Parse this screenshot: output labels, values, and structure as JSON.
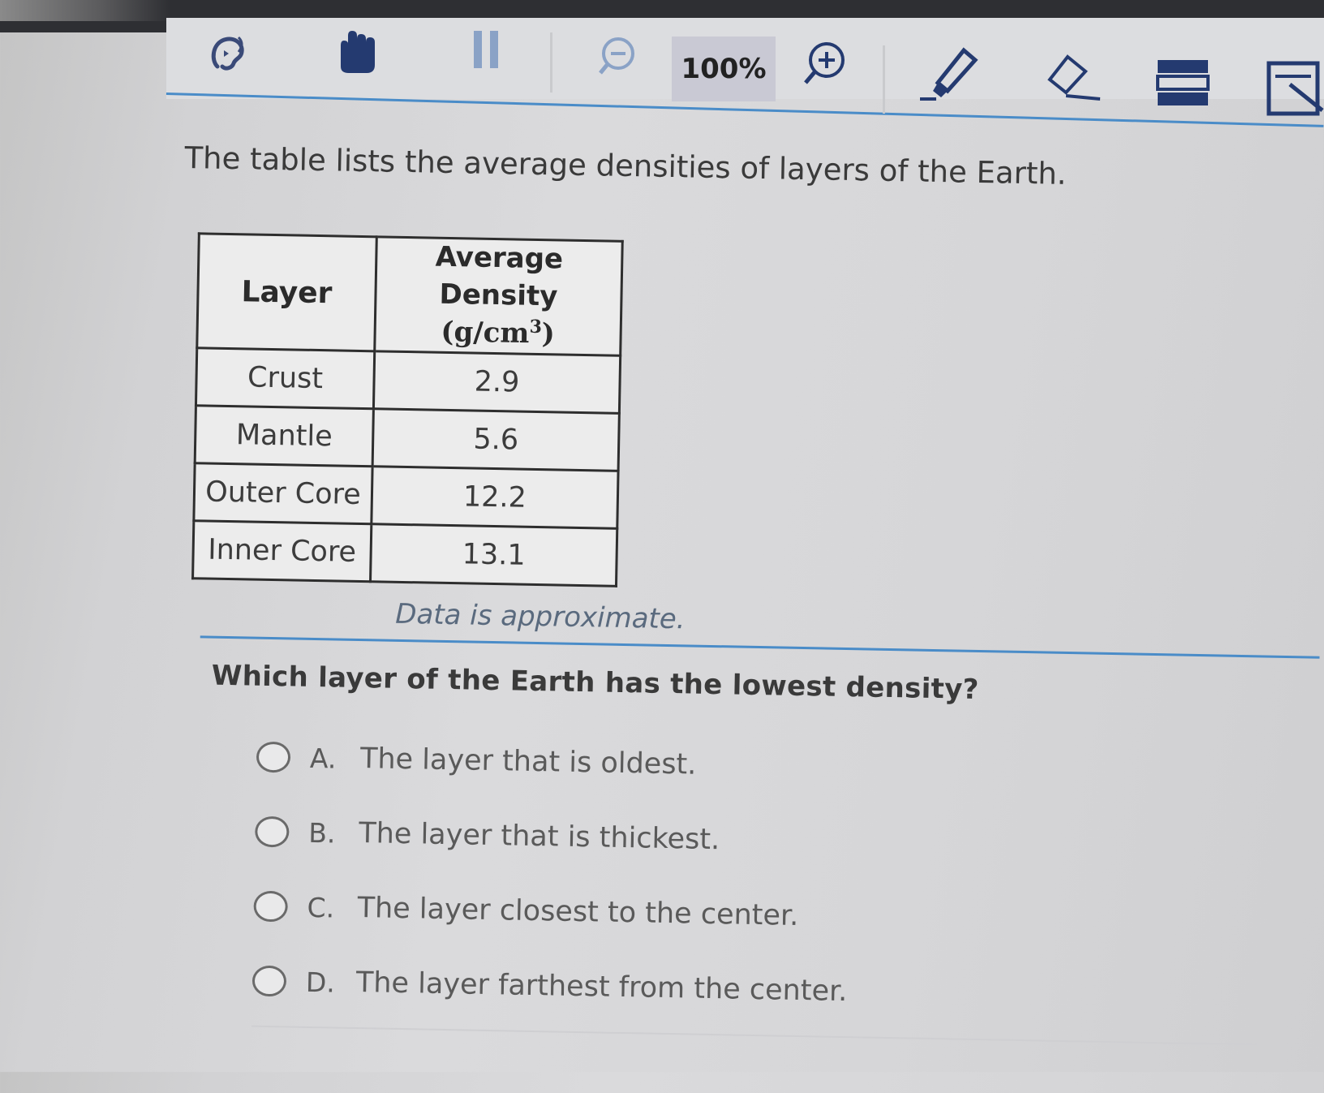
{
  "toolbar": {
    "tools": [
      {
        "name": "text-to-speech-icon"
      },
      {
        "name": "hand-pointer-icon"
      },
      {
        "name": "pause-icon"
      },
      {
        "name": "zoom-out-icon"
      },
      {
        "name": "zoom-in-icon"
      },
      {
        "name": "highlighter-icon"
      },
      {
        "name": "eraser-icon"
      },
      {
        "name": "line-reader-icon"
      },
      {
        "name": "notepad-icon"
      }
    ],
    "zoom_level": "100%",
    "accent_color": "#4a8cc8"
  },
  "question": {
    "intro": "The table lists the average densities of layers of the Earth.",
    "table": {
      "headers": {
        "layer": "Layer",
        "density": "Average Density",
        "unit_base": "(g/cm",
        "unit_exp": "3",
        "unit_close": ")"
      },
      "rows": [
        {
          "layer": "Crust",
          "density": "2.9"
        },
        {
          "layer": "Mantle",
          "density": "5.6"
        },
        {
          "layer": "Outer Core",
          "density": "12.2"
        },
        {
          "layer": "Inner Core",
          "density": "13.1"
        }
      ]
    },
    "note": "Data is approximate.",
    "prompt": "Which layer of the Earth has the lowest density?",
    "choices": [
      {
        "letter": "A.",
        "text": "The layer that is oldest."
      },
      {
        "letter": "B.",
        "text": "The layer that is thickest."
      },
      {
        "letter": "C.",
        "text": "The layer closest to the center."
      },
      {
        "letter": "D.",
        "text": "The layer farthest from the center."
      }
    ]
  }
}
